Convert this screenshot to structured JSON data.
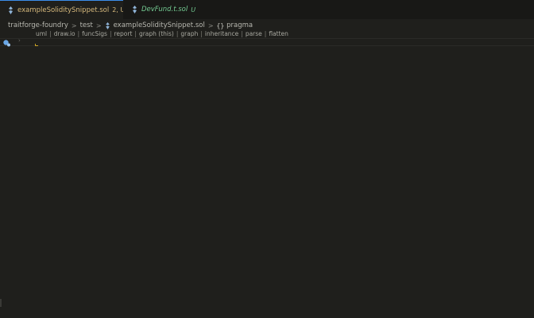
{
  "tabs": [
    {
      "label": "exampleSoliditySnippet.sol",
      "badge": "2, U",
      "state": "active",
      "dirty": true,
      "icon": "solidity-file-icon"
    },
    {
      "label": "DevFund.t.sol",
      "badge": "U",
      "state": "inactive",
      "dirty": false,
      "icon": "solidity-file-icon"
    }
  ],
  "breadcrumb": {
    "items": [
      "traitforge-foundry",
      "test",
      "exampleSoliditySnippet.sol",
      "pragma"
    ],
    "separator": ">",
    "symbol_icon": "{}"
  },
  "codelens": {
    "items": [
      "uml",
      "draw.io",
      "funcSigs",
      "report",
      "graph (this)",
      "graph",
      "inheritance",
      "parse",
      "flatten"
    ],
    "separator": "|"
  },
  "gutter": {
    "fold_glyph": "›"
  },
  "colors": {
    "background": "#1f1f1c",
    "tabbar": "#181816",
    "modified": "#d7ba7d",
    "untracked": "#73c991",
    "active_tab_border": "#3b8eea"
  }
}
